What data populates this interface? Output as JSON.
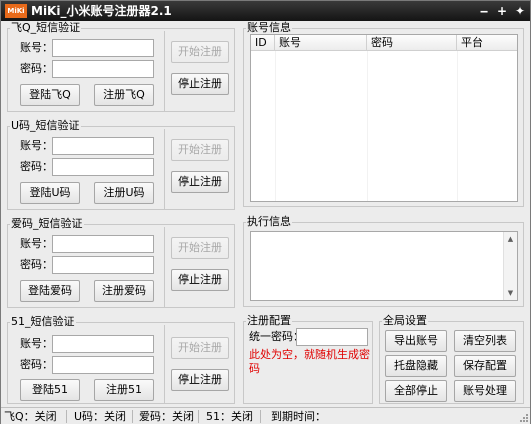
{
  "window": {
    "icon_text": "MiKi",
    "title": "MiKi_小米账号注册器2.1",
    "minimize": "‒",
    "maximize": "+",
    "close": "✦"
  },
  "groups": [
    {
      "title": "飞Q_短信验证",
      "account_label": "账号：",
      "password_label": "密码：",
      "account_value": "",
      "password_value": "",
      "login_button": "登陆飞Q",
      "register_button": "注册飞Q",
      "start_button": "开始注册",
      "stop_button": "停止注册"
    },
    {
      "title": "U码_短信验证",
      "account_label": "账号：",
      "password_label": "密码：",
      "account_value": "",
      "password_value": "",
      "login_button": "登陆U码",
      "register_button": "注册U码",
      "start_button": "开始注册",
      "stop_button": "停止注册"
    },
    {
      "title": "爱码_短信验证",
      "account_label": "账号：",
      "password_label": "密码：",
      "account_value": "",
      "password_value": "",
      "login_button": "登陆爱码",
      "register_button": "注册爱码",
      "start_button": "开始注册",
      "stop_button": "停止注册"
    },
    {
      "title": "51_短信验证",
      "account_label": "账号：",
      "password_label": "密码：",
      "account_value": "",
      "password_value": "",
      "login_button": "登陆51",
      "register_button": "注册51",
      "start_button": "开始注册",
      "stop_button": "停止注册"
    }
  ],
  "account_info": {
    "title": "账号信息",
    "columns": [
      "ID",
      "账号",
      "密码",
      "平台"
    ],
    "rows": []
  },
  "exec_info": {
    "title": "执行信息",
    "text": ""
  },
  "register_config": {
    "title": "注册配置",
    "password_label": "统一密码：",
    "password_value": "",
    "hint": "此处为空，就随机生成密码"
  },
  "global_settings": {
    "title": "全局设置",
    "buttons": [
      "导出账号",
      "清空列表",
      "托盘隐藏",
      "保存配置",
      "全部停止",
      "账号处理"
    ]
  },
  "status_bar": {
    "items": [
      "飞Q：关闭",
      "U码：关闭",
      "爱码：关闭",
      "51：关闭",
      "到期时间："
    ]
  }
}
